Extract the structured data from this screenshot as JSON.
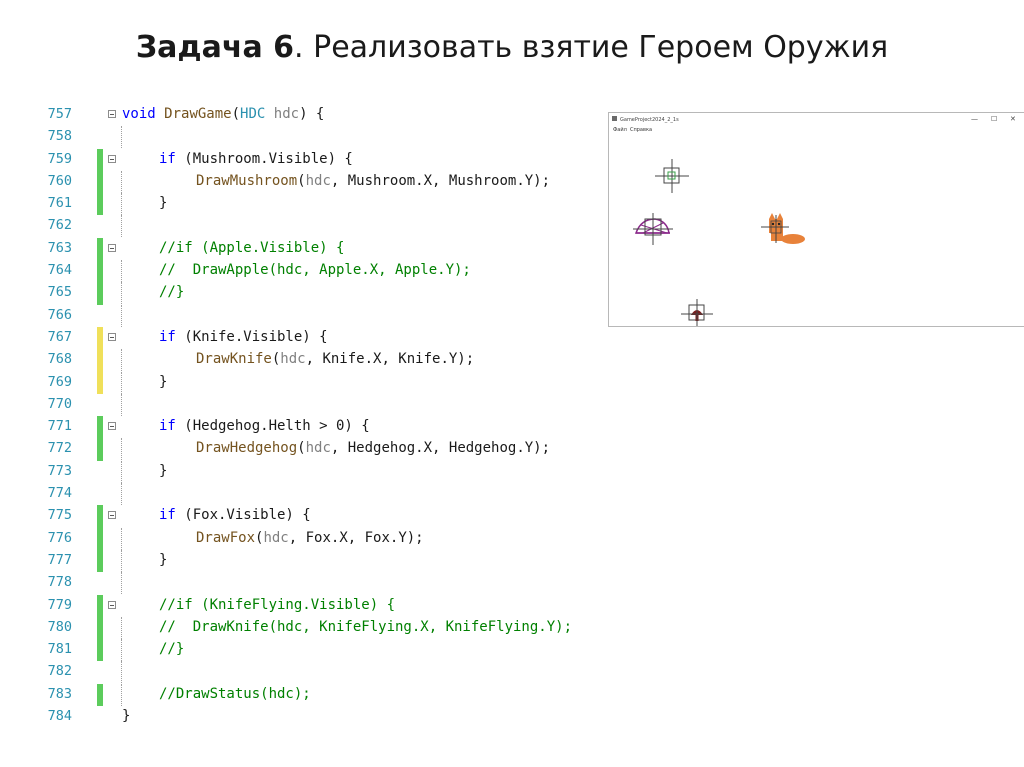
{
  "slide": {
    "title_bold": "Задача 6",
    "title_rest": ". Реализовать взятие Героем Оружия"
  },
  "code": {
    "lines": [
      {
        "num": "757",
        "text": "void DrawGame(HDC hdc) {"
      },
      {
        "num": "758",
        "text": ""
      },
      {
        "num": "759",
        "text": "if (Mushroom.Visible) {"
      },
      {
        "num": "760",
        "text": "DrawMushroom(hdc, Mushroom.X, Mushroom.Y);"
      },
      {
        "num": "761",
        "text": "}"
      },
      {
        "num": "762",
        "text": ""
      },
      {
        "num": "763",
        "text": "//if (Apple.Visible) {"
      },
      {
        "num": "764",
        "text": "//  DrawApple(hdc, Apple.X, Apple.Y);"
      },
      {
        "num": "765",
        "text": "//}"
      },
      {
        "num": "766",
        "text": ""
      },
      {
        "num": "767",
        "text": "if (Knife.Visible) {"
      },
      {
        "num": "768",
        "text": "DrawKnife(hdc, Knife.X, Knife.Y);"
      },
      {
        "num": "769",
        "text": "}"
      },
      {
        "num": "770",
        "text": ""
      },
      {
        "num": "771",
        "text": "if (Hedgehog.Helth > 0) {"
      },
      {
        "num": "772",
        "text": "DrawHedgehog(hdc, Hedgehog.X, Hedgehog.Y);"
      },
      {
        "num": "773",
        "text": "}"
      },
      {
        "num": "774",
        "text": ""
      },
      {
        "num": "775",
        "text": "if (Fox.Visible) {"
      },
      {
        "num": "776",
        "text": "DrawFox(hdc, Fox.X, Fox.Y);"
      },
      {
        "num": "777",
        "text": "}"
      },
      {
        "num": "778",
        "text": ""
      },
      {
        "num": "779",
        "text": "//if (KnifeFlying.Visible) {"
      },
      {
        "num": "780",
        "text": "//  DrawKnife(hdc, KnifeFlying.X, KnifeFlying.Y);"
      },
      {
        "num": "781",
        "text": "//}"
      },
      {
        "num": "782",
        "text": ""
      },
      {
        "num": "783",
        "text": "//DrawStatus(hdc);"
      },
      {
        "num": "784",
        "text": "}"
      }
    ]
  },
  "app_window": {
    "title": "GameProject2024_2_1s",
    "menu": [
      "Файл",
      "Справка"
    ],
    "window_controls": [
      "—",
      "☐",
      "✕"
    ]
  },
  "colors": {
    "keyword": "#0000ff",
    "function": "#74531f",
    "comment": "#008000",
    "parameter": "#808080",
    "type": "#2b91af",
    "line_number": "#2b91af",
    "change_saved": "#5ccc5c",
    "change_unsaved": "#f0e05a",
    "fox": "#e8823a",
    "hedgehog": "#8b2a8b"
  }
}
